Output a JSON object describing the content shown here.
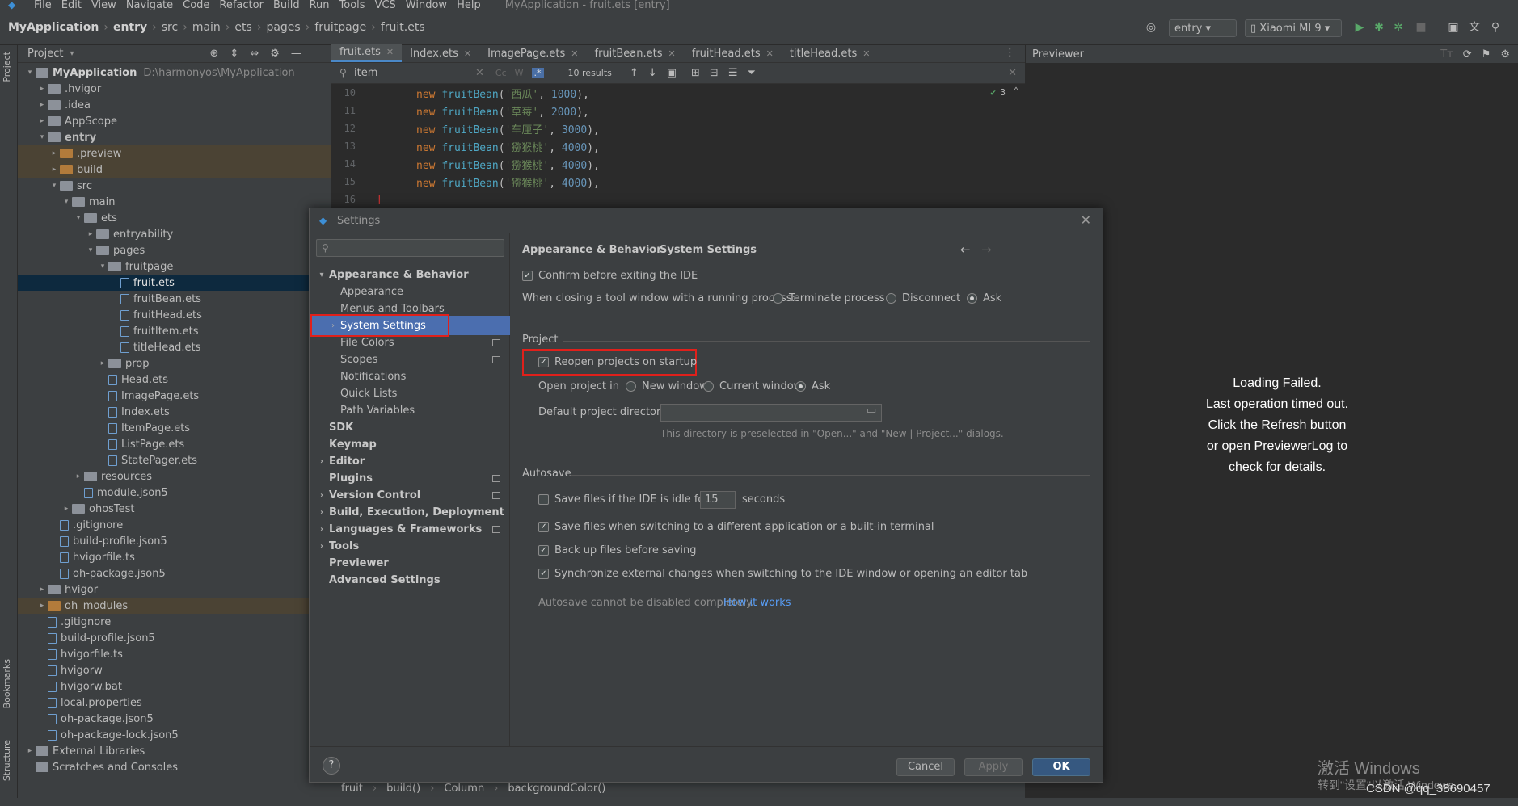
{
  "menu": [
    "File",
    "Edit",
    "View",
    "Navigate",
    "Code",
    "Refactor",
    "Build",
    "Run",
    "Tools",
    "VCS",
    "Window",
    "Help"
  ],
  "window_title": "MyApplication - fruit.ets [entry]",
  "breadcrumb": [
    "MyApplication",
    "entry",
    "src",
    "main",
    "ets",
    "pages",
    "fruitpage",
    "fruit.ets"
  ],
  "toolbar": {
    "module": "entry",
    "device": "Xiaomi MI 9"
  },
  "left_strip": {
    "project": "Project",
    "bookmarks": "Bookmarks",
    "structure": "Structure"
  },
  "project_panel": {
    "title": "Project",
    "root_name": "MyApplication",
    "root_path": "D:\\harmonyos\\MyApplication",
    "items": [
      {
        "label": ".hvigor"
      },
      {
        "label": ".idea"
      },
      {
        "label": "AppScope"
      },
      {
        "label": "entry"
      },
      {
        "label": ".preview"
      },
      {
        "label": "build"
      },
      {
        "label": "src"
      },
      {
        "label": "main"
      },
      {
        "label": "ets"
      },
      {
        "label": "entryability"
      },
      {
        "label": "pages"
      },
      {
        "label": "fruitpage"
      },
      {
        "label": "fruit.ets"
      },
      {
        "label": "fruitBean.ets"
      },
      {
        "label": "fruitHead.ets"
      },
      {
        "label": "fruitItem.ets"
      },
      {
        "label": "titleHead.ets"
      },
      {
        "label": "prop"
      },
      {
        "label": "Head.ets"
      },
      {
        "label": "ImagePage.ets"
      },
      {
        "label": "Index.ets"
      },
      {
        "label": "ItemPage.ets"
      },
      {
        "label": "ListPage.ets"
      },
      {
        "label": "StatePager.ets"
      },
      {
        "label": "resources"
      },
      {
        "label": "module.json5"
      },
      {
        "label": "ohosTest"
      },
      {
        "label": ".gitignore"
      },
      {
        "label": "build-profile.json5"
      },
      {
        "label": "hvigorfile.ts"
      },
      {
        "label": "oh-package.json5"
      },
      {
        "label": "hvigor"
      },
      {
        "label": "oh_modules"
      },
      {
        "label": ".gitignore"
      },
      {
        "label": "build-profile.json5"
      },
      {
        "label": "hvigorfile.ts"
      },
      {
        "label": "hvigorw"
      },
      {
        "label": "hvigorw.bat"
      },
      {
        "label": "local.properties"
      },
      {
        "label": "oh-package.json5"
      },
      {
        "label": "oh-package-lock.json5"
      },
      {
        "label": "External Libraries"
      },
      {
        "label": "Scratches and Consoles"
      }
    ]
  },
  "editor_tabs": [
    "fruit.ets",
    "Index.ets",
    "ImagePage.ets",
    "fruitBean.ets",
    "fruitHead.ets",
    "titleHead.ets"
  ],
  "search": {
    "query": "item",
    "results": "10 results",
    "match_count": "3"
  },
  "code": {
    "line_numbers": [
      "10",
      "11",
      "12",
      "13",
      "14",
      "15",
      "16"
    ],
    "lines": [
      {
        "kw": "new",
        "cls": "fruitBean",
        "str": "'西瓜'",
        "num": "1000"
      },
      {
        "kw": "new",
        "cls": "fruitBean",
        "str": "'草莓'",
        "num": "2000"
      },
      {
        "kw": "new",
        "cls": "fruitBean",
        "str": "'车厘子'",
        "num": "3000"
      },
      {
        "kw": "new",
        "cls": "fruitBean",
        "str": "'猕猴桃'",
        "num": "4000"
      },
      {
        "kw": "new",
        "cls": "fruitBean",
        "str": "'猕猴桃'",
        "num": "4000"
      },
      {
        "kw": "new",
        "cls": "fruitBean",
        "str": "'猕猴桃'",
        "num": "4000"
      }
    ],
    "closing": "]"
  },
  "editor_footer": [
    "fruit",
    "build()",
    "Column",
    "backgroundColor()"
  ],
  "previewer": {
    "title": "Previewer",
    "message": [
      "Loading Failed.",
      "Last operation timed out.",
      "Click the Refresh button",
      "or open PreviewerLog to",
      "check for details."
    ]
  },
  "watermark": {
    "line1": "激活 Windows",
    "line2": "转到\"设置\"以激活 Windows。",
    "csdn": "CSDN @qq_38690457"
  },
  "dialog": {
    "title": "Settings",
    "search_placeholder": "",
    "sidebar": [
      {
        "label": "Appearance & Behavior"
      },
      {
        "label": "Appearance"
      },
      {
        "label": "Menus and Toolbars"
      },
      {
        "label": "System Settings"
      },
      {
        "label": "File Colors"
      },
      {
        "label": "Scopes"
      },
      {
        "label": "Notifications"
      },
      {
        "label": "Quick Lists"
      },
      {
        "label": "Path Variables"
      },
      {
        "label": "SDK"
      },
      {
        "label": "Keymap"
      },
      {
        "label": "Editor"
      },
      {
        "label": "Plugins"
      },
      {
        "label": "Version Control"
      },
      {
        "label": "Build, Execution, Deployment"
      },
      {
        "label": "Languages & Frameworks"
      },
      {
        "label": "Tools"
      },
      {
        "label": "Previewer"
      },
      {
        "label": "Advanced Settings"
      }
    ],
    "crumb1": "Appearance & Behavior",
    "crumb2": "System Settings",
    "confirm_exit": "Confirm before exiting the IDE",
    "closing_label": "When closing a tool window with a running process:",
    "closing_options": [
      "Terminate process",
      "Disconnect",
      "Ask"
    ],
    "project_section": "Project",
    "reopen": "Reopen projects on startup",
    "open_in_label": "Open project in",
    "open_in_options": [
      "New window",
      "Current window",
      "Ask"
    ],
    "default_dir_label": "Default project directory:",
    "default_dir_value": "",
    "default_dir_hint": "This directory is preselected in \"Open...\" and \"New | Project...\" dialogs.",
    "autosave_section": "Autosave",
    "save_idle": "Save files if the IDE is idle for",
    "idle_seconds": "15",
    "seconds": "seconds",
    "save_switch": "Save files when switching to a different application or a built-in terminal",
    "backup": "Back up files before saving",
    "sync": "Synchronize external changes when switching to the IDE window or opening an editor tab",
    "autosave_note": "Autosave cannot be disabled completely.",
    "how_it_works": "How it works",
    "buttons": {
      "cancel": "Cancel",
      "apply": "Apply",
      "ok": "OK"
    },
    "help": "?"
  },
  "colors": {
    "accent": "#4b6eaf",
    "highlight_red": "#e0201b",
    "link": "#589df6"
  }
}
